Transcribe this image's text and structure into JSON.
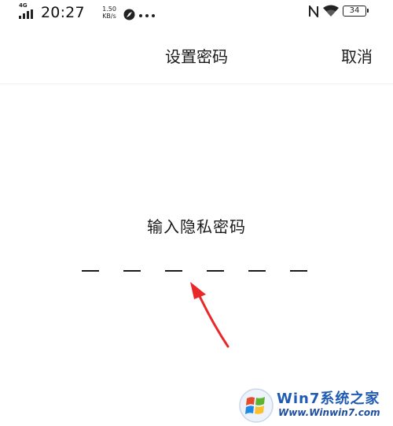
{
  "status_bar": {
    "network_type": "4G",
    "time": "20:27",
    "speed_value": "1.50",
    "speed_unit": "KB/s",
    "battery": "34"
  },
  "header": {
    "title": "设置密码",
    "cancel_label": "取消"
  },
  "pin_entry": {
    "prompt": "输入隐私密码",
    "slot_count": 6,
    "entered_count": 0
  },
  "watermark": {
    "title": "Win7系统之家",
    "url": "Www.Winwin7.com"
  },
  "colors": {
    "text": "#1a1a1a",
    "arrow": "#e8282b",
    "watermark_blue": "#1f5bb5"
  }
}
